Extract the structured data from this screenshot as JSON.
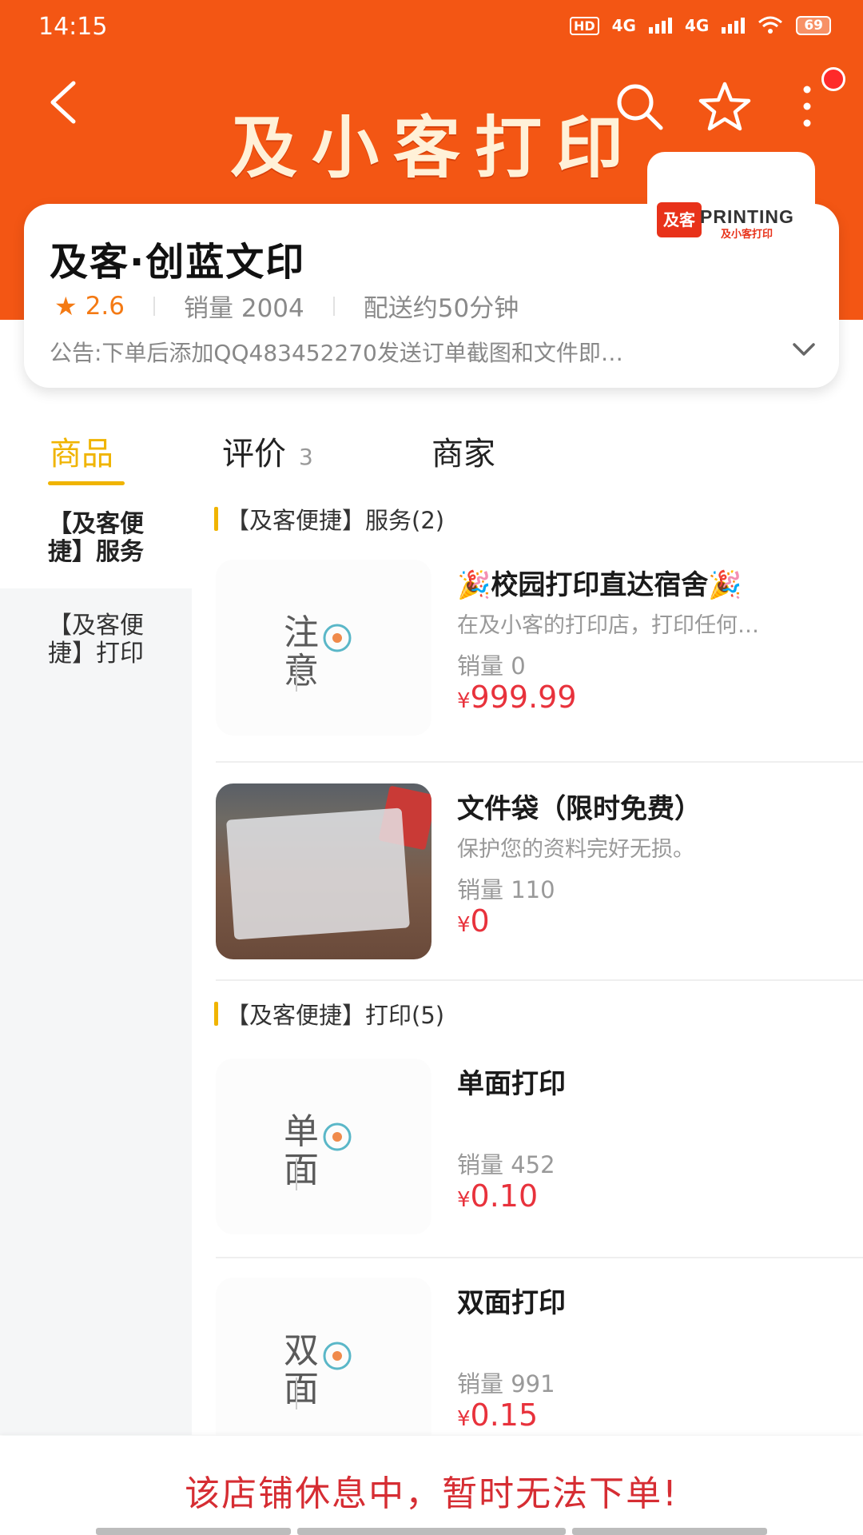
{
  "status_bar": {
    "time": "14:15",
    "network_1": "4G",
    "network_2": "4G",
    "hd_label": "HD",
    "battery": "69"
  },
  "header": {
    "banner_title": "及小客打印",
    "icons": [
      "back-arrow-icon",
      "search-icon",
      "star-icon",
      "more-vertical-icon"
    ],
    "brand_color": "#f35614"
  },
  "shop": {
    "name": "及客·创蓝文印",
    "rating": "2.6",
    "sales": "销量 2004",
    "delivery": "配送约50分钟",
    "notice": "公告:下单后添加QQ483452270发送订单截图和文件即…",
    "logo": {
      "mark": "及客",
      "printing": "PRINTING",
      "sub": "及小客打印"
    }
  },
  "tabs": {
    "goods": "商品",
    "reviews": "评价",
    "reviews_count": "3",
    "merchant": "商家",
    "active_color": "#f0b400"
  },
  "sidebar": {
    "items": [
      {
        "label": "【及客便捷】服务"
      },
      {
        "label": "【及客便捷】打印"
      }
    ]
  },
  "sections": [
    {
      "title": "【及客便捷】服务(2)",
      "products": [
        {
          "name": "🎉校园打印直达宿舍🎉",
          "desc": "在及小客的打印店，打印任何…",
          "sales": "销量 0",
          "currency": "¥",
          "price": "999.99",
          "image_text": [
            "注",
            "意"
          ]
        },
        {
          "name": "文件袋（限时免费）",
          "desc": "保护您的资料完好无损。",
          "sales": "销量 110",
          "currency": "¥",
          "price": "0"
        }
      ]
    },
    {
      "title": "【及客便捷】打印(5)",
      "products": [
        {
          "name": "单面打印",
          "desc": "",
          "sales": "销量 452",
          "currency": "¥",
          "price": "0.10",
          "image_text": [
            "单",
            "面"
          ]
        },
        {
          "name": "双面打印",
          "desc": "",
          "sales": "销量 991",
          "currency": "¥",
          "price": "0.15",
          "image_text": [
            "双",
            "面"
          ]
        }
      ]
    }
  ],
  "footer": {
    "closed_message": "该店铺休息中，暂时无法下单!",
    "price_color": "#e8323c"
  }
}
